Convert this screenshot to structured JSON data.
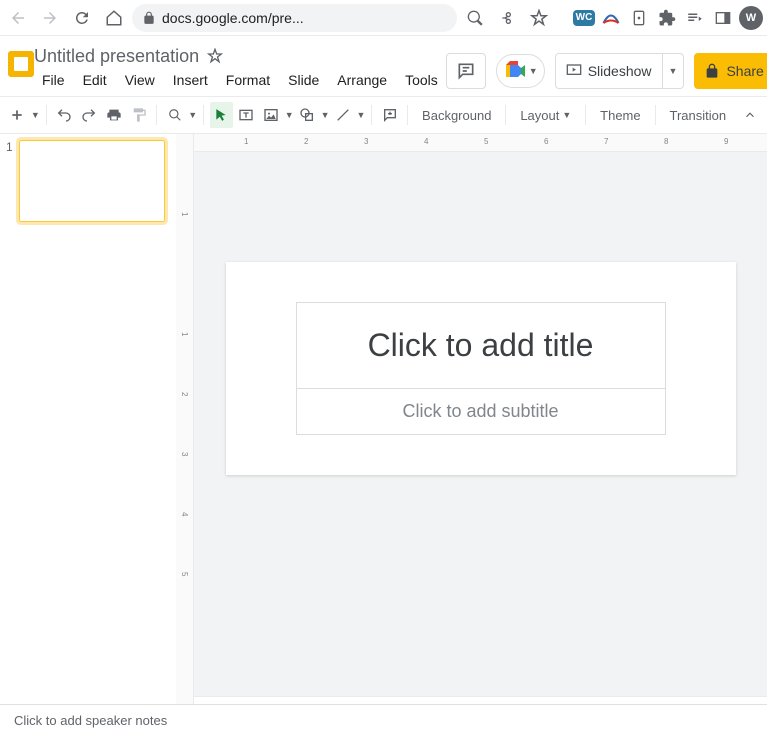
{
  "browser": {
    "url": "docs.google.com/pre...",
    "wc_label": "WC",
    "avatar_letter": "W"
  },
  "header": {
    "doc_title": "Untitled presentation",
    "menus": [
      "File",
      "Edit",
      "View",
      "Insert",
      "Format",
      "Slide",
      "Arrange",
      "Tools"
    ],
    "slideshow": "Slideshow",
    "share": "Share"
  },
  "toolbar": {
    "background": "Background",
    "layout": "Layout",
    "theme": "Theme",
    "transition": "Transition"
  },
  "panel": {
    "slide_num": "1"
  },
  "slide": {
    "title_placeholder": "Click to add title",
    "subtitle_placeholder": "Click to add subtitle"
  },
  "ruler": {
    "h": [
      "1",
      "2",
      "3",
      "4",
      "5",
      "6",
      "7",
      "8",
      "9"
    ],
    "v": [
      "1",
      "1",
      "2",
      "3",
      "4",
      "5"
    ]
  },
  "notes": {
    "placeholder": "Click to add speaker notes"
  }
}
